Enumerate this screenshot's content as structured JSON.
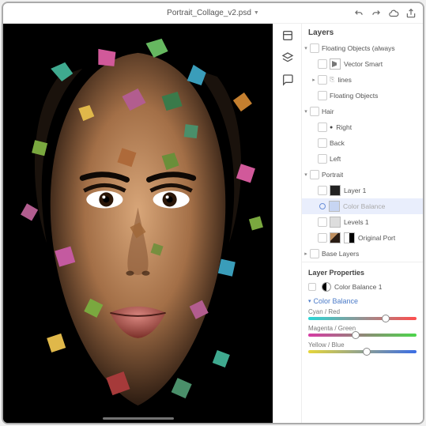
{
  "header": {
    "filename": "Portrait_Collage_v2.psd"
  },
  "panels": {
    "layers_title": "Layers",
    "layer_props_title": "Layer Properties",
    "color_balance_title": "Color Balance"
  },
  "layers": {
    "group_floating_always": "Floating Objects (always",
    "vector_smart": "Vector Smart",
    "lines": "lines",
    "floating_objects": "Floating Objects",
    "hair": "Hair",
    "right": "Right",
    "back": "Back",
    "left": "Left",
    "portrait": "Portrait",
    "layer1": "Layer 1",
    "color_balance_layer": "Color Balance",
    "levels1": "Levels 1",
    "original_portrait": "Original Port",
    "base_layers": "Base Layers"
  },
  "properties": {
    "adjustment_name": "Color Balance 1"
  },
  "sliders": {
    "cyan_red": {
      "label": "Cyan / Red",
      "pos": 68
    },
    "magenta_green": {
      "label": "Magenta / Green",
      "pos": 40
    },
    "yellow_blue": {
      "label": "Yellow / Blue",
      "pos": 50
    }
  }
}
